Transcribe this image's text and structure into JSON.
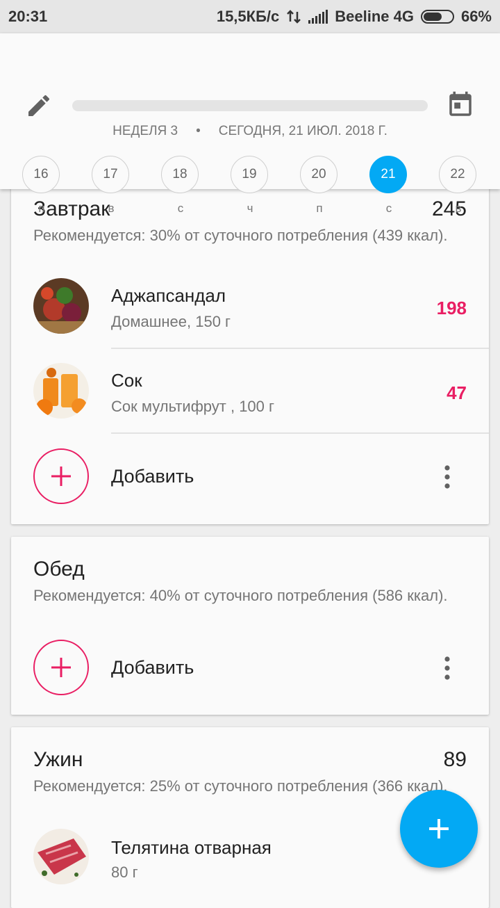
{
  "status_bar": {
    "time": "20:31",
    "speed": "15,5КБ/с",
    "carrier": "Beeline 4G",
    "battery": "66%",
    "battery_level": 0.66
  },
  "header": {
    "week": "НЕДЕЛЯ 3",
    "separator": "•",
    "today": "СЕГОДНЯ, 21 ИЮЛ. 2018 Г.",
    "days": [
      {
        "num": "16",
        "letter": "п"
      },
      {
        "num": "17",
        "letter": "в"
      },
      {
        "num": "18",
        "letter": "с"
      },
      {
        "num": "19",
        "letter": "ч"
      },
      {
        "num": "20",
        "letter": "п"
      },
      {
        "num": "21",
        "letter": "с"
      },
      {
        "num": "22",
        "letter": "в"
      }
    ],
    "selected_day": "21"
  },
  "meals": {
    "breakfast": {
      "title": "Завтрак",
      "total": "245",
      "recommended": "Рекомендуется: 30% от суточного потребления (439 ккал).",
      "items": [
        {
          "name": "Аджапсандал",
          "detail": "Домашнее, 150 г",
          "kcal": "198"
        },
        {
          "name": "Сок",
          "detail": "Сок мультифрут , 100 г",
          "kcal": "47"
        }
      ],
      "add_label": "Добавить"
    },
    "lunch": {
      "title": "Обед",
      "recommended": "Рекомендуется: 40% от суточного потребления (586 ккал).",
      "add_label": "Добавить"
    },
    "dinner": {
      "title": "Ужин",
      "total": "89",
      "recommended": "Рекомендуется: 25% от суточного потребления (366 ккал).",
      "items": [
        {
          "name": "Телятина отварная",
          "detail": "80 г"
        }
      ]
    }
  },
  "colors": {
    "accent": "#03a9f4",
    "kcal": "#e91e63"
  }
}
